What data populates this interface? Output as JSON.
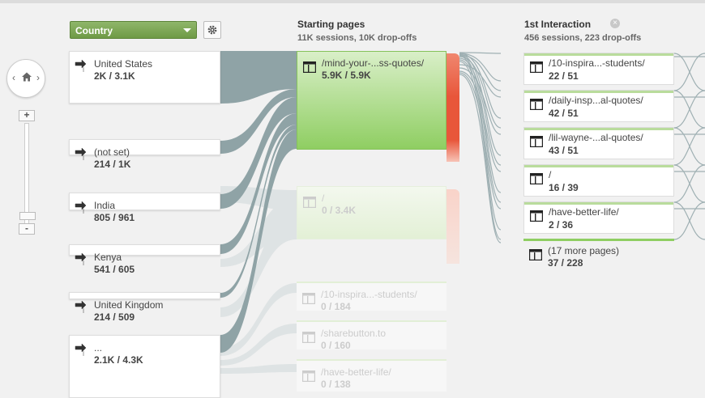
{
  "dimension": {
    "selected": "Country"
  },
  "columns": {
    "starting": {
      "title": "Starting pages",
      "subtitle": "11K sessions, 10K drop-offs"
    },
    "first": {
      "title": "1st Interaction",
      "subtitle": "456 sessions, 223 drop-offs"
    }
  },
  "icons": {
    "home": "home-icon",
    "settings": "gear-icon",
    "entry": "entry-arrow-icon",
    "page": "page-icon",
    "close": "close-icon",
    "zoom_in": "+",
    "zoom_out": "-",
    "pan_left": "‹",
    "pan_right": "›"
  },
  "countries": [
    {
      "label": "United States",
      "value": "2K / 3.1K"
    },
    {
      "label": "(not set)",
      "value": "214 / 1K"
    },
    {
      "label": "India",
      "value": "805 / 961"
    },
    {
      "label": "Kenya",
      "value": "541 / 605"
    },
    {
      "label": "United Kingdom",
      "value": "214 / 509"
    },
    {
      "label": "...",
      "value": "2.1K / 4.3K"
    }
  ],
  "starting_pages": [
    {
      "label": "/mind-your-...ss-quotes/",
      "value": "5.9K / 5.9K"
    },
    {
      "label": "/",
      "value": "0 / 3.4K"
    },
    {
      "label": "/10-inspira...-students/",
      "value": "0 / 184"
    },
    {
      "label": "/sharebutton.to",
      "value": "0 / 160"
    },
    {
      "label": "/have-better-life/",
      "value": "0 / 138"
    }
  ],
  "first_interaction": [
    {
      "label": "/10-inspira...-students/",
      "value": "22 / 51"
    },
    {
      "label": "/daily-insp...al-quotes/",
      "value": "42 / 51"
    },
    {
      "label": "/lil-wayne-...al-quotes/",
      "value": "43 / 51"
    },
    {
      "label": "/",
      "value": "16 / 39"
    },
    {
      "label": "/have-better-life/",
      "value": "2 / 36"
    },
    {
      "label": "(17 more pages)",
      "value": "37 / 228"
    }
  ],
  "colors": {
    "flow": "#8fa3a6",
    "flow_light": "#dde2e3",
    "selected_dropdown": "#7ba655",
    "page_active": "#8fce62",
    "dropoff": "#e8563a",
    "interaction_bar": "#b9dc9c"
  }
}
